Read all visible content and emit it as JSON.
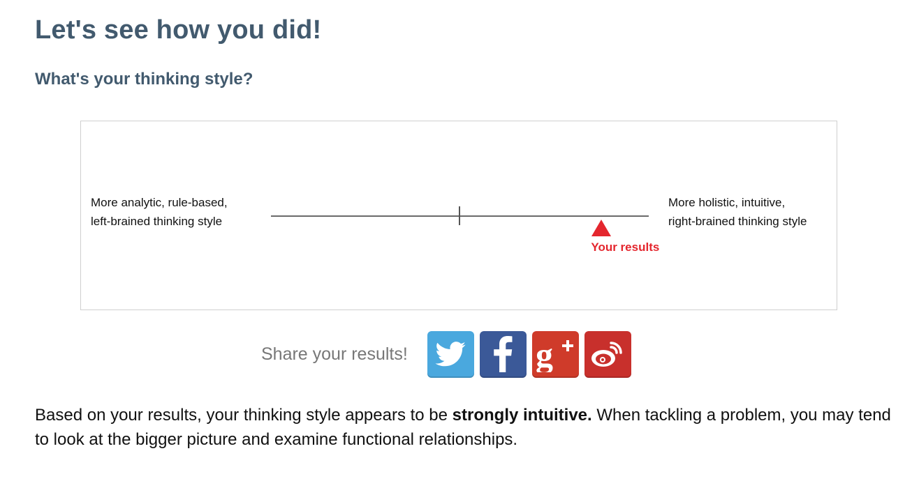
{
  "page": {
    "title": "Let's see how you did!",
    "section_title": "What's your thinking style?"
  },
  "scale": {
    "left_label": "More analytic, rule-based,\nleft-brained thinking style",
    "right_label": "More holistic, intuitive,\nright-brained thinking style",
    "result_label": "Your results",
    "result_position": 0.875,
    "marker_color": "#e4262e"
  },
  "share": {
    "label": "Share your results!",
    "buttons": [
      {
        "network": "Twitter",
        "icon": "twitter-icon",
        "color": "#4aa8de"
      },
      {
        "network": "Facebook",
        "icon": "facebook-icon",
        "color": "#3b5998"
      },
      {
        "network": "Google+",
        "icon": "google-plus-icon",
        "color": "#cf3b2a"
      },
      {
        "network": "Weibo",
        "icon": "weibo-icon",
        "color": "#c8302c"
      }
    ]
  },
  "result_text": {
    "prefix": "Based on your results, your thinking style appears to be ",
    "emphasis": "strongly intuitive.",
    "suffix": " When tackling a problem, you may tend to look at the bigger picture and examine functional relationships."
  }
}
